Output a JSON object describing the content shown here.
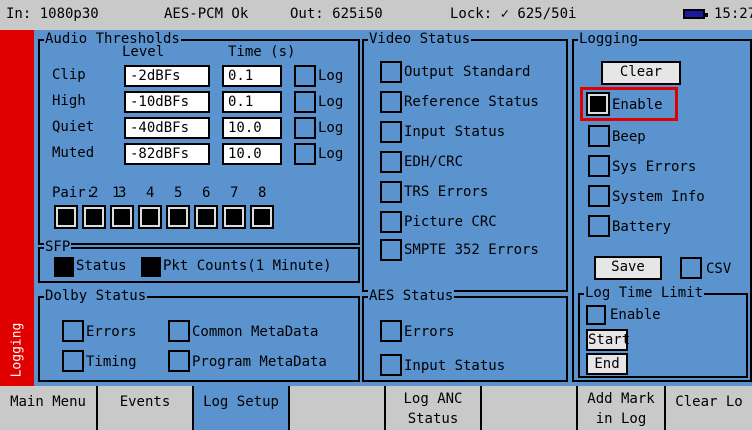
{
  "statusbar": {
    "input": "In: 1080p30",
    "audio": "AES-PCM Ok",
    "output": "Out: 625i50",
    "lock": "Lock: ✓ 625/50i",
    "time": "15:27"
  },
  "side_tab": {
    "label": "Logging"
  },
  "audio_thresholds": {
    "title": "Audio Thresholds",
    "col_level": "Level",
    "col_time": "Time (s)",
    "rows": [
      {
        "label": "Clip",
        "level": "-2dBFs",
        "time": "0.1",
        "log_label": "Log",
        "log": false
      },
      {
        "label": "High",
        "level": "-10dBFs",
        "time": "0.1",
        "log_label": "Log",
        "log": false
      },
      {
        "label": "Quiet",
        "level": "-40dBFs",
        "time": "10.0",
        "log_label": "Log",
        "log": false
      },
      {
        "label": "Muted",
        "level": "-82dBFs",
        "time": "10.0",
        "log_label": "Log",
        "log": false
      }
    ],
    "pair_label": "Pair:",
    "pairs": [
      "1",
      "2",
      "3",
      "4",
      "5",
      "6",
      "7",
      "8"
    ],
    "pairs_checked": [
      true,
      true,
      true,
      true,
      true,
      true,
      true,
      true
    ]
  },
  "sfp": {
    "title": "SFP",
    "status_label": "Status",
    "status_checked": true,
    "pkt_label": "Pkt Counts(1 Minute)",
    "pkt_checked": true
  },
  "dolby_status": {
    "title": "Dolby Status",
    "items": [
      {
        "label": "Errors",
        "checked": false
      },
      {
        "label": "Common MetaData",
        "checked": false
      },
      {
        "label": "Timing",
        "checked": false
      },
      {
        "label": "Program MetaData",
        "checked": false
      }
    ]
  },
  "video_status": {
    "title": "Video Status",
    "items": [
      {
        "label": "Output Standard",
        "checked": false
      },
      {
        "label": "Reference Status",
        "checked": false
      },
      {
        "label": "Input Status",
        "checked": false
      },
      {
        "label": "EDH/CRC",
        "checked": false
      },
      {
        "label": "TRS Errors",
        "checked": false
      },
      {
        "label": "Picture CRC",
        "checked": false
      },
      {
        "label": "SMPTE 352 Errors",
        "checked": false
      }
    ]
  },
  "aes_status": {
    "title": "AES Status",
    "items": [
      {
        "label": "Errors",
        "checked": false
      },
      {
        "label": "Input Status",
        "checked": false
      }
    ]
  },
  "logging": {
    "title": "Logging",
    "clear_label": "Clear",
    "items": [
      {
        "label": "Enable",
        "checked": true
      },
      {
        "label": "Beep",
        "checked": false
      },
      {
        "label": "Sys Errors",
        "checked": false
      },
      {
        "label": "System Info",
        "checked": false
      },
      {
        "label": "Battery",
        "checked": false
      }
    ],
    "save_label": "Save",
    "csv_label": "CSV",
    "csv_checked": false
  },
  "log_time_limit": {
    "title": "Log Time Limit",
    "enable_label": "Enable",
    "enable_checked": false,
    "start_label": "Start",
    "end_label": "End"
  },
  "softkeys": [
    {
      "label": "Main Menu",
      "active": false
    },
    {
      "label": "Events",
      "active": false
    },
    {
      "label": "Log Setup",
      "active": true
    },
    {
      "label": "",
      "active": false
    },
    {
      "label": "Log ANC Status",
      "active": false
    },
    {
      "label": "",
      "active": false
    },
    {
      "label": "Add Mark in Log",
      "active": false
    },
    {
      "label": "Clear Lo",
      "active": false
    }
  ],
  "colors": {
    "panel": "#5b93cf",
    "highlight": "#e00000",
    "bars": "#c9c9c9"
  },
  "icons": [
    "battery-icon",
    "checkmark-icon"
  ]
}
